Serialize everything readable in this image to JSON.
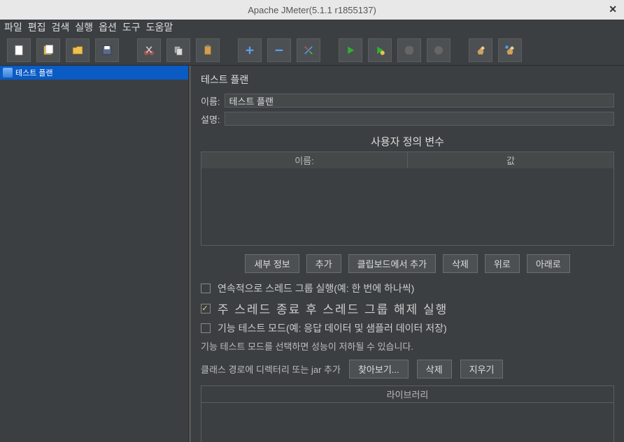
{
  "titlebar": {
    "title": "Apache JMeter(5.1.1 r1855137)"
  },
  "menu": {
    "file": "파일",
    "edit": "편집",
    "search": "검색",
    "run": "실행",
    "options": "옵션",
    "tools": "도구",
    "help": "도움말"
  },
  "tree": {
    "item_label": "테스트 플랜"
  },
  "panel": {
    "title": "테스트 플랜",
    "name_label": "이름:",
    "name_value": "테스트 플랜",
    "desc_label": "설명:",
    "desc_value": ""
  },
  "vars": {
    "title": "사용자 정의 변수",
    "col_name": "이름:",
    "col_value": "값"
  },
  "buttons": {
    "detail": "세부 정보",
    "add": "추가",
    "from_clipboard": "클립보드에서 추가",
    "delete": "삭제",
    "up": "위로",
    "down": "아래로"
  },
  "checks": {
    "serial": "연속적으로 스레드 그룹 실행(예: 한 번에 하나씩)",
    "teardown": "주 스레드 종료 후 스레드 그룹 해제 실행",
    "functional": "기능 테스트 모드(예: 응답 데이터 및 샘플러 데이터 저장)"
  },
  "note": "기능 테스트 모드를 선택하면 성능이 저하될 수 있습니다.",
  "classpath": {
    "label": "클래스 경로에 디렉터리 또는 jar 추가",
    "browse": "찾아보기...",
    "delete": "삭제",
    "clear": "지우기"
  },
  "lib": {
    "title": "라이브러리"
  }
}
